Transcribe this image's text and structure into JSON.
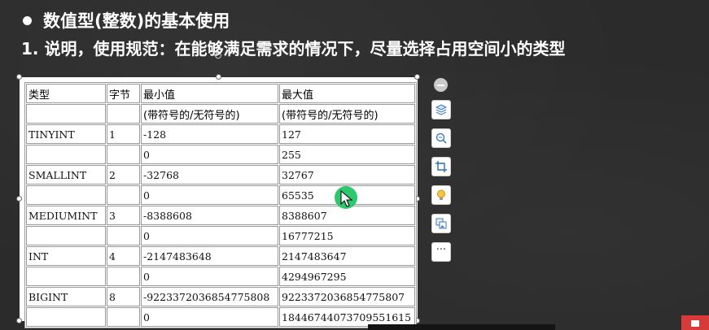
{
  "slide": {
    "title": "数值型(整数)的基本使用",
    "subtitle": "1. 说明，使用规范：在能够满足需求的情况下，尽量选择占用空间小的类型"
  },
  "table": {
    "headers": [
      "类型",
      "字节",
      "最小值",
      "最大值"
    ],
    "signed_note": [
      "",
      "",
      "(带符号的/无符号的)",
      "(带符号的/无符号的)"
    ],
    "rows": [
      [
        "TINYINT",
        "1",
        "-128",
        "127"
      ],
      [
        "",
        "",
        "0",
        "255"
      ],
      [
        "SMALLINT",
        "2",
        "-32768",
        "32767"
      ],
      [
        "",
        "",
        "0",
        "65535"
      ],
      [
        "MEDIUMINT",
        "3",
        "-8388608",
        "8388607"
      ],
      [
        "",
        "",
        "0",
        "16777215"
      ],
      [
        "INT",
        "4",
        "-2147483648",
        "2147483647"
      ],
      [
        "",
        "",
        "0",
        "4294967295"
      ],
      [
        "BIGINT",
        "8",
        "-9223372036854775808",
        "9223372036854775807"
      ],
      [
        "",
        "",
        "0",
        "18446744073709551615"
      ]
    ]
  },
  "toolbar": {
    "buttons": [
      "collapse-icon",
      "layers-icon",
      "zoom-icon",
      "crop-icon",
      "lightbulb-icon",
      "replace-image-icon",
      "more-icon"
    ],
    "more_label": "···"
  },
  "colors": {
    "background": "#2b2b2b",
    "cursor_marker": "#2ec86e",
    "badge": "#d83a3a"
  }
}
